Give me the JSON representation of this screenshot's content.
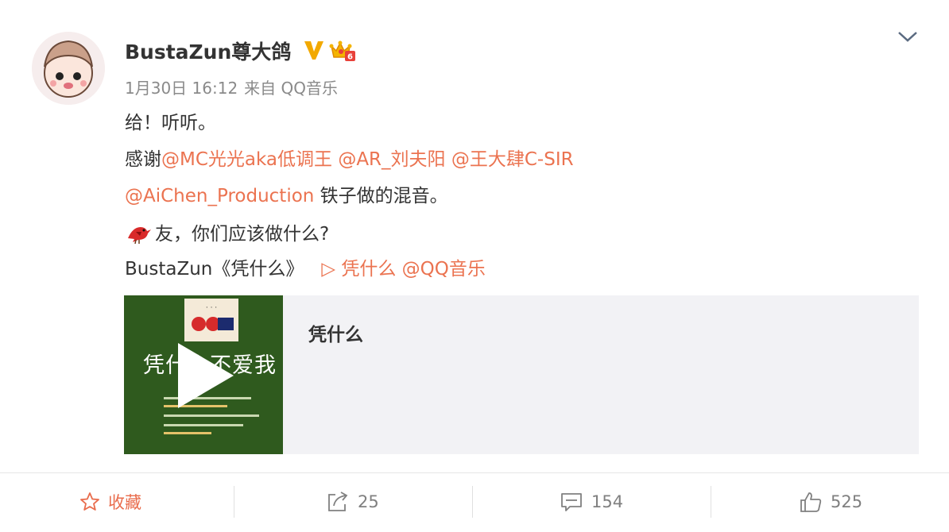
{
  "post": {
    "username": "BustaZun尊大鸽",
    "date": "1月30日 16:12",
    "source": "来自 QQ音乐",
    "line1": "给！听听。",
    "line2_prefix": "感谢",
    "mention_mc": "@MC光光aka低调王",
    "mention_ar": "@AR_刘夫阳",
    "mention_wang": "@王大肆C-SIR",
    "mention_aichen": "@AiChen_Production",
    "line3_suffix": " 铁子做的混音。",
    "line4_text": "友，你们应该做什么?",
    "line5_prefix": "BustaZun《凭什么》",
    "music_link": "▷ 凭什么 @QQ音乐"
  },
  "card": {
    "title": "凭什么",
    "thumb_text": "凭什么不爱我"
  },
  "actions": {
    "favorite_label": "收藏",
    "share_count": "25",
    "comment_count": "154",
    "like_count": "525"
  },
  "icons": {
    "verified": "v-badge-icon",
    "vip": "crown-icon",
    "expand": "chevron-down-icon",
    "bird": "bird-emoji-icon",
    "play": "play-icon",
    "favorite": "star-icon",
    "share": "share-icon",
    "comment": "comment-icon",
    "like": "thumbs-up-icon"
  },
  "colors": {
    "accent": "#eb7350",
    "text": "#333333",
    "meta": "#8a8a8a",
    "verified": "#f2a900"
  }
}
